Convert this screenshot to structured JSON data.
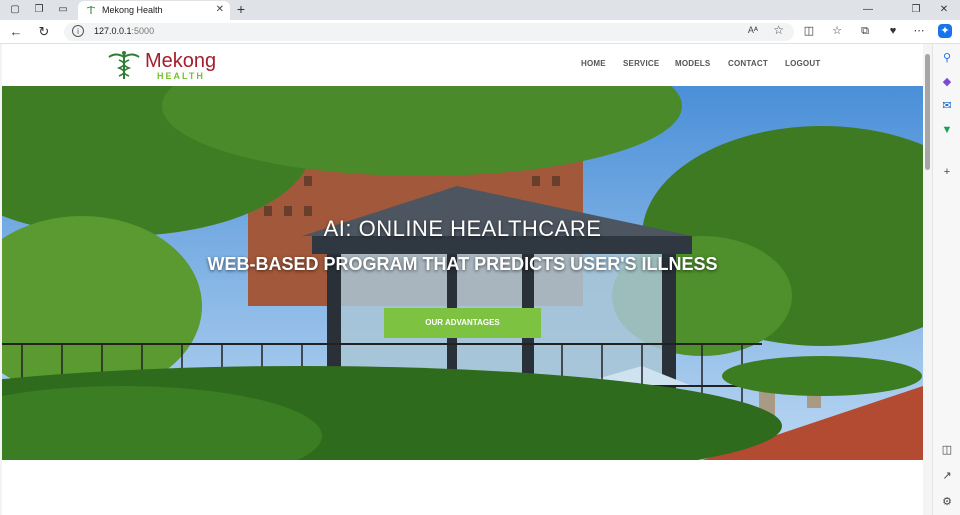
{
  "browser": {
    "tab_title": "Mekong Health",
    "url_host": "127.0.0.1",
    "url_port": ":5000",
    "reading_icon": "read-aloud-icon",
    "colors": {
      "tabstrip": "#dfe3e8",
      "accent": "#1a73e8"
    }
  },
  "site": {
    "logo_brand": "Mekong",
    "logo_sub": "HEALTH",
    "nav": [
      "HOME",
      "SERVICE",
      "MODELS",
      "CONTACT",
      "LOGOUT"
    ],
    "colors": {
      "brand_red": "#a51d2d",
      "brand_green": "#7dc240"
    }
  },
  "hero": {
    "title": "AI: ONLINE HEALTHCARE",
    "subtitle": "WEB-BASED PROGRAM THAT PREDICTS USER'S ILLNESS",
    "button": "OUR ADVANTAGES"
  }
}
